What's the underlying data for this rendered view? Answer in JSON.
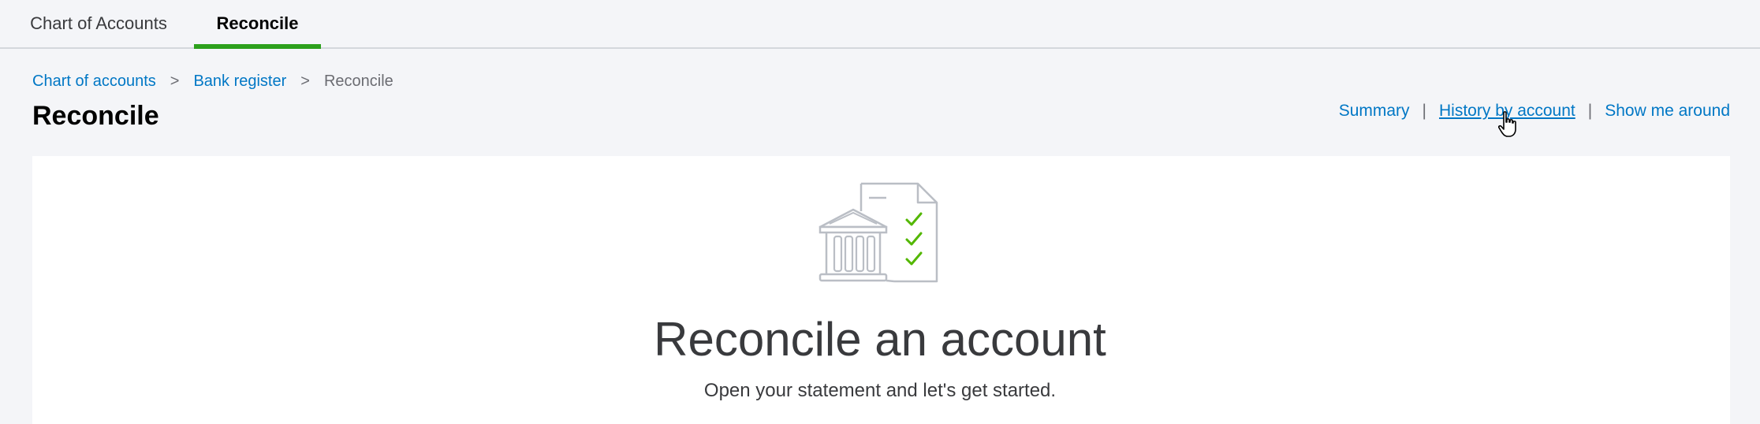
{
  "tabs": [
    {
      "label": "Chart of Accounts",
      "active": false
    },
    {
      "label": "Reconcile",
      "active": true
    }
  ],
  "breadcrumb": {
    "items": [
      "Chart of accounts",
      "Bank register",
      "Reconcile"
    ],
    "separator": ">"
  },
  "page": {
    "title": "Reconcile"
  },
  "actions": {
    "summary": "Summary",
    "history": "History by account",
    "tour": "Show me around",
    "separator": "|"
  },
  "hero": {
    "icon": "bank-checklist-icon",
    "title": "Reconcile an account",
    "subtitle": "Open your statement and let's get started."
  },
  "colors": {
    "accent_green": "#2ca01c",
    "link_blue": "#0077c5",
    "text_dark": "#393a3d",
    "background": "#f4f5f8"
  }
}
